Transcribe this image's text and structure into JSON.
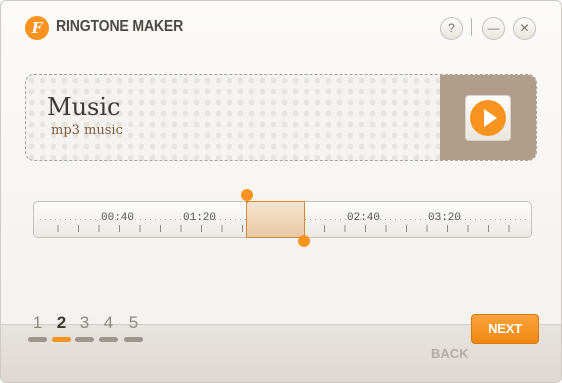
{
  "app": {
    "title": "RINGTONE MAKER",
    "logo_letter": "F",
    "help_label": "?",
    "minimize_label": "—",
    "close_label": "✕"
  },
  "card": {
    "title": "Music",
    "subtitle": "mp3 music"
  },
  "timeline": {
    "labels": [
      "00:40",
      "01:20",
      "02:40",
      "03:20"
    ],
    "selection_start": "01:52",
    "selection_end": "02:10"
  },
  "steps": [
    {
      "num": "1",
      "active": false
    },
    {
      "num": "2",
      "active": true
    },
    {
      "num": "3",
      "active": false
    },
    {
      "num": "4",
      "active": false
    },
    {
      "num": "5",
      "active": false
    }
  ],
  "buttons": {
    "next": "NEXT",
    "back": "BACK"
  },
  "colors": {
    "accent": "#f7931e",
    "text_dark": "#3f3934",
    "card_side": "#b29d8a"
  }
}
